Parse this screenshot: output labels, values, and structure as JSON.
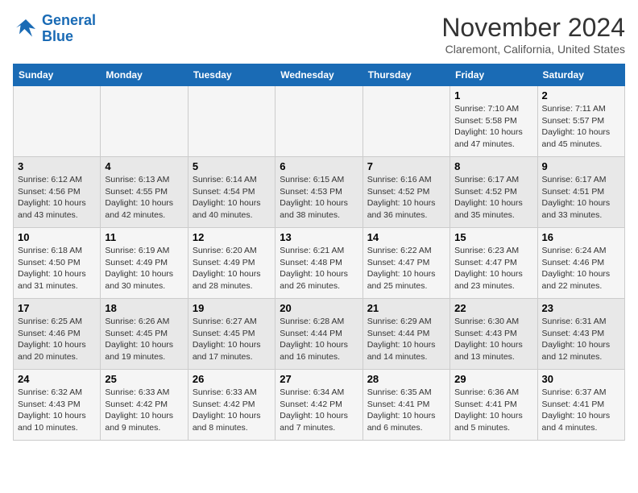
{
  "header": {
    "logo_line1": "General",
    "logo_line2": "Blue",
    "month": "November 2024",
    "location": "Claremont, California, United States"
  },
  "weekdays": [
    "Sunday",
    "Monday",
    "Tuesday",
    "Wednesday",
    "Thursday",
    "Friday",
    "Saturday"
  ],
  "weeks": [
    [
      {
        "day": "",
        "info": ""
      },
      {
        "day": "",
        "info": ""
      },
      {
        "day": "",
        "info": ""
      },
      {
        "day": "",
        "info": ""
      },
      {
        "day": "",
        "info": ""
      },
      {
        "day": "1",
        "info": "Sunrise: 7:10 AM\nSunset: 5:58 PM\nDaylight: 10 hours\nand 47 minutes."
      },
      {
        "day": "2",
        "info": "Sunrise: 7:11 AM\nSunset: 5:57 PM\nDaylight: 10 hours\nand 45 minutes."
      }
    ],
    [
      {
        "day": "3",
        "info": "Sunrise: 6:12 AM\nSunset: 4:56 PM\nDaylight: 10 hours\nand 43 minutes."
      },
      {
        "day": "4",
        "info": "Sunrise: 6:13 AM\nSunset: 4:55 PM\nDaylight: 10 hours\nand 42 minutes."
      },
      {
        "day": "5",
        "info": "Sunrise: 6:14 AM\nSunset: 4:54 PM\nDaylight: 10 hours\nand 40 minutes."
      },
      {
        "day": "6",
        "info": "Sunrise: 6:15 AM\nSunset: 4:53 PM\nDaylight: 10 hours\nand 38 minutes."
      },
      {
        "day": "7",
        "info": "Sunrise: 6:16 AM\nSunset: 4:52 PM\nDaylight: 10 hours\nand 36 minutes."
      },
      {
        "day": "8",
        "info": "Sunrise: 6:17 AM\nSunset: 4:52 PM\nDaylight: 10 hours\nand 35 minutes."
      },
      {
        "day": "9",
        "info": "Sunrise: 6:17 AM\nSunset: 4:51 PM\nDaylight: 10 hours\nand 33 minutes."
      }
    ],
    [
      {
        "day": "10",
        "info": "Sunrise: 6:18 AM\nSunset: 4:50 PM\nDaylight: 10 hours\nand 31 minutes."
      },
      {
        "day": "11",
        "info": "Sunrise: 6:19 AM\nSunset: 4:49 PM\nDaylight: 10 hours\nand 30 minutes."
      },
      {
        "day": "12",
        "info": "Sunrise: 6:20 AM\nSunset: 4:49 PM\nDaylight: 10 hours\nand 28 minutes."
      },
      {
        "day": "13",
        "info": "Sunrise: 6:21 AM\nSunset: 4:48 PM\nDaylight: 10 hours\nand 26 minutes."
      },
      {
        "day": "14",
        "info": "Sunrise: 6:22 AM\nSunset: 4:47 PM\nDaylight: 10 hours\nand 25 minutes."
      },
      {
        "day": "15",
        "info": "Sunrise: 6:23 AM\nSunset: 4:47 PM\nDaylight: 10 hours\nand 23 minutes."
      },
      {
        "day": "16",
        "info": "Sunrise: 6:24 AM\nSunset: 4:46 PM\nDaylight: 10 hours\nand 22 minutes."
      }
    ],
    [
      {
        "day": "17",
        "info": "Sunrise: 6:25 AM\nSunset: 4:46 PM\nDaylight: 10 hours\nand 20 minutes."
      },
      {
        "day": "18",
        "info": "Sunrise: 6:26 AM\nSunset: 4:45 PM\nDaylight: 10 hours\nand 19 minutes."
      },
      {
        "day": "19",
        "info": "Sunrise: 6:27 AM\nSunset: 4:45 PM\nDaylight: 10 hours\nand 17 minutes."
      },
      {
        "day": "20",
        "info": "Sunrise: 6:28 AM\nSunset: 4:44 PM\nDaylight: 10 hours\nand 16 minutes."
      },
      {
        "day": "21",
        "info": "Sunrise: 6:29 AM\nSunset: 4:44 PM\nDaylight: 10 hours\nand 14 minutes."
      },
      {
        "day": "22",
        "info": "Sunrise: 6:30 AM\nSunset: 4:43 PM\nDaylight: 10 hours\nand 13 minutes."
      },
      {
        "day": "23",
        "info": "Sunrise: 6:31 AM\nSunset: 4:43 PM\nDaylight: 10 hours\nand 12 minutes."
      }
    ],
    [
      {
        "day": "24",
        "info": "Sunrise: 6:32 AM\nSunset: 4:43 PM\nDaylight: 10 hours\nand 10 minutes."
      },
      {
        "day": "25",
        "info": "Sunrise: 6:33 AM\nSunset: 4:42 PM\nDaylight: 10 hours\nand 9 minutes."
      },
      {
        "day": "26",
        "info": "Sunrise: 6:33 AM\nSunset: 4:42 PM\nDaylight: 10 hours\nand 8 minutes."
      },
      {
        "day": "27",
        "info": "Sunrise: 6:34 AM\nSunset: 4:42 PM\nDaylight: 10 hours\nand 7 minutes."
      },
      {
        "day": "28",
        "info": "Sunrise: 6:35 AM\nSunset: 4:41 PM\nDaylight: 10 hours\nand 6 minutes."
      },
      {
        "day": "29",
        "info": "Sunrise: 6:36 AM\nSunset: 4:41 PM\nDaylight: 10 hours\nand 5 minutes."
      },
      {
        "day": "30",
        "info": "Sunrise: 6:37 AM\nSunset: 4:41 PM\nDaylight: 10 hours\nand 4 minutes."
      }
    ]
  ]
}
